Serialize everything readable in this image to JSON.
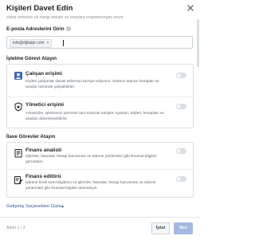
{
  "dialog": {
    "title": "Kişileri Davet Edin"
  },
  "intro_cut": "sahip olmasını ve hangi reklam ve araçlara erişebileceğini seçin.",
  "email": {
    "label": "E-posta Adreslerini Girin",
    "info_icon": "i",
    "chip_value": "info@dijitalpr.com",
    "chip_remove": "×"
  },
  "business_roles": {
    "heading": "İşletme Görevi Atayın",
    "items": [
      {
        "icon": "person-icon",
        "title": "Çalışan erişimi",
        "description": "Kişileri çalışanlar olarak eklemeyi tavsiye ediyoruz. Sadece atanan hesaplar ve araçlar üzerinde çalışabilirler."
      },
      {
        "icon": "shield-icon",
        "title": "Yönetici erişimi",
        "description": "Yöneticiler, işletmeniz üzerinde tam kontrole sahiptir. Ayarları, kişileri, hesapları ve araçları düzenleyebilirler."
      }
    ]
  },
  "additional_roles": {
    "heading": "İlave Görevler Atayın",
    "items": [
      {
        "icon": "finance-analyst-icon",
        "title": "Finans analisti",
        "description": "İşlemler, faturalar, hesap harcaması ve ödeme yöntemleri gibi finansal bilgileri görüntüler."
      },
      {
        "icon": "finance-editor-icon",
        "title": "Finans editörü",
        "description": "İşletme kredi kartı bilgilerini ve işlemler, faturalar, hesap harcaması ve ödeme yöntemleri gibi finansal bilgileri düzenleyin."
      }
    ]
  },
  "advanced_link": "Gelişmiş Seçenekleri Gizle",
  "advanced_link_arrow": "▴",
  "footer": {
    "step": "Adım 1 / 3",
    "cancel": "İptal",
    "next": "İleri"
  },
  "colors": {
    "link": "#365899",
    "next_button": "#a5b8e2",
    "toggle_off": "#dadde1"
  }
}
